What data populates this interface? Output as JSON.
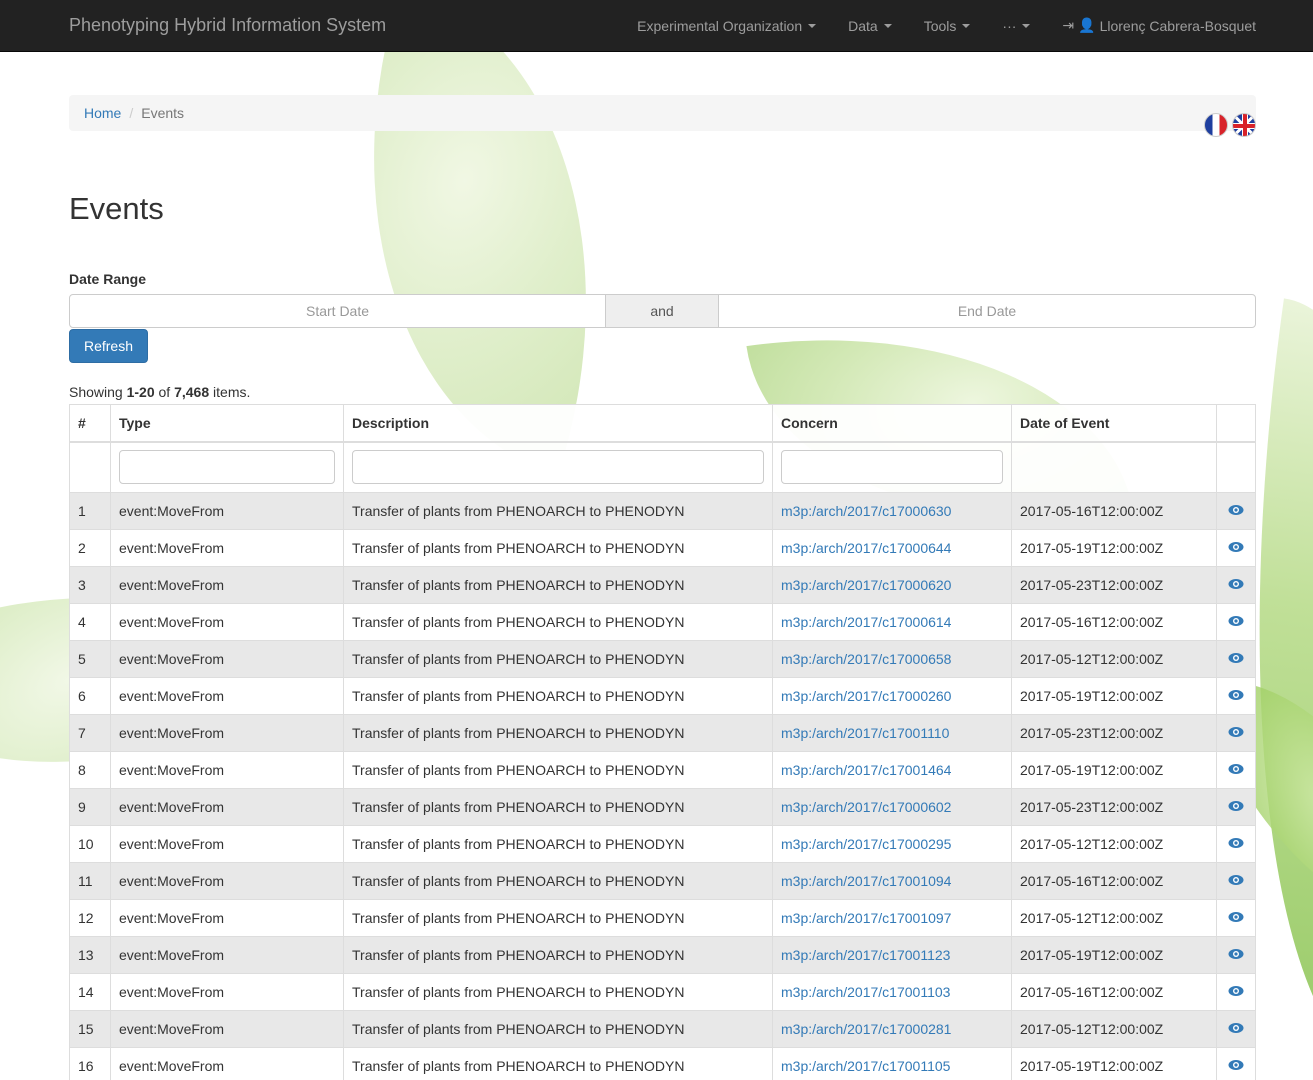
{
  "navbar": {
    "brand": "Phenotyping Hybrid Information System",
    "items": [
      {
        "label": "Experimental Organization"
      },
      {
        "label": "Data"
      },
      {
        "label": "Tools"
      },
      {
        "label": "···"
      }
    ],
    "user": "Llorenç Cabrera-Bosquet"
  },
  "breadcrumb": {
    "home": "Home",
    "current": "Events"
  },
  "page": {
    "title": "Events",
    "date_range_label": "Date Range",
    "start_placeholder": "Start Date",
    "and_label": "and",
    "end_placeholder": "End Date",
    "refresh_label": "Refresh"
  },
  "summary": {
    "prefix": "Showing ",
    "range": "1-20",
    "mid": " of ",
    "total": "7,468",
    "suffix": " items."
  },
  "table": {
    "headers": [
      "#",
      "Type",
      "Description",
      "Concern",
      "Date of Event"
    ],
    "rows": [
      {
        "num": "1",
        "type": "event:MoveFrom",
        "desc": "Transfer of plants from PHENOARCH to PHENODYN",
        "concern": "m3p:/arch/2017/c17000630",
        "date": "2017-05-16T12:00:00Z"
      },
      {
        "num": "2",
        "type": "event:MoveFrom",
        "desc": "Transfer of plants from PHENOARCH to PHENODYN",
        "concern": "m3p:/arch/2017/c17000644",
        "date": "2017-05-19T12:00:00Z"
      },
      {
        "num": "3",
        "type": "event:MoveFrom",
        "desc": "Transfer of plants from PHENOARCH to PHENODYN",
        "concern": "m3p:/arch/2017/c17000620",
        "date": "2017-05-23T12:00:00Z"
      },
      {
        "num": "4",
        "type": "event:MoveFrom",
        "desc": "Transfer of plants from PHENOARCH to PHENODYN",
        "concern": "m3p:/arch/2017/c17000614",
        "date": "2017-05-16T12:00:00Z"
      },
      {
        "num": "5",
        "type": "event:MoveFrom",
        "desc": "Transfer of plants from PHENOARCH to PHENODYN",
        "concern": "m3p:/arch/2017/c17000658",
        "date": "2017-05-12T12:00:00Z"
      },
      {
        "num": "6",
        "type": "event:MoveFrom",
        "desc": "Transfer of plants from PHENOARCH to PHENODYN",
        "concern": "m3p:/arch/2017/c17000260",
        "date": "2017-05-19T12:00:00Z"
      },
      {
        "num": "7",
        "type": "event:MoveFrom",
        "desc": "Transfer of plants from PHENOARCH to PHENODYN",
        "concern": "m3p:/arch/2017/c17001110",
        "date": "2017-05-23T12:00:00Z"
      },
      {
        "num": "8",
        "type": "event:MoveFrom",
        "desc": "Transfer of plants from PHENOARCH to PHENODYN",
        "concern": "m3p:/arch/2017/c17001464",
        "date": "2017-05-19T12:00:00Z"
      },
      {
        "num": "9",
        "type": "event:MoveFrom",
        "desc": "Transfer of plants from PHENOARCH to PHENODYN",
        "concern": "m3p:/arch/2017/c17000602",
        "date": "2017-05-23T12:00:00Z"
      },
      {
        "num": "10",
        "type": "event:MoveFrom",
        "desc": "Transfer of plants from PHENOARCH to PHENODYN",
        "concern": "m3p:/arch/2017/c17000295",
        "date": "2017-05-12T12:00:00Z"
      },
      {
        "num": "11",
        "type": "event:MoveFrom",
        "desc": "Transfer of plants from PHENOARCH to PHENODYN",
        "concern": "m3p:/arch/2017/c17001094",
        "date": "2017-05-16T12:00:00Z"
      },
      {
        "num": "12",
        "type": "event:MoveFrom",
        "desc": "Transfer of plants from PHENOARCH to PHENODYN",
        "concern": "m3p:/arch/2017/c17001097",
        "date": "2017-05-12T12:00:00Z"
      },
      {
        "num": "13",
        "type": "event:MoveFrom",
        "desc": "Transfer of plants from PHENOARCH to PHENODYN",
        "concern": "m3p:/arch/2017/c17001123",
        "date": "2017-05-19T12:00:00Z"
      },
      {
        "num": "14",
        "type": "event:MoveFrom",
        "desc": "Transfer of plants from PHENOARCH to PHENODYN",
        "concern": "m3p:/arch/2017/c17001103",
        "date": "2017-05-16T12:00:00Z"
      },
      {
        "num": "15",
        "type": "event:MoveFrom",
        "desc": "Transfer of plants from PHENOARCH to PHENODYN",
        "concern": "m3p:/arch/2017/c17000281",
        "date": "2017-05-12T12:00:00Z"
      },
      {
        "num": "16",
        "type": "event:MoveFrom",
        "desc": "Transfer of plants from PHENOARCH to PHENODYN",
        "concern": "m3p:/arch/2017/c17001105",
        "date": "2017-05-19T12:00:00Z"
      }
    ]
  },
  "colors": {
    "navbar_bg": "#222222",
    "link": "#337ab7",
    "primary": "#337ab7",
    "stripe": "#e8e8e8"
  }
}
